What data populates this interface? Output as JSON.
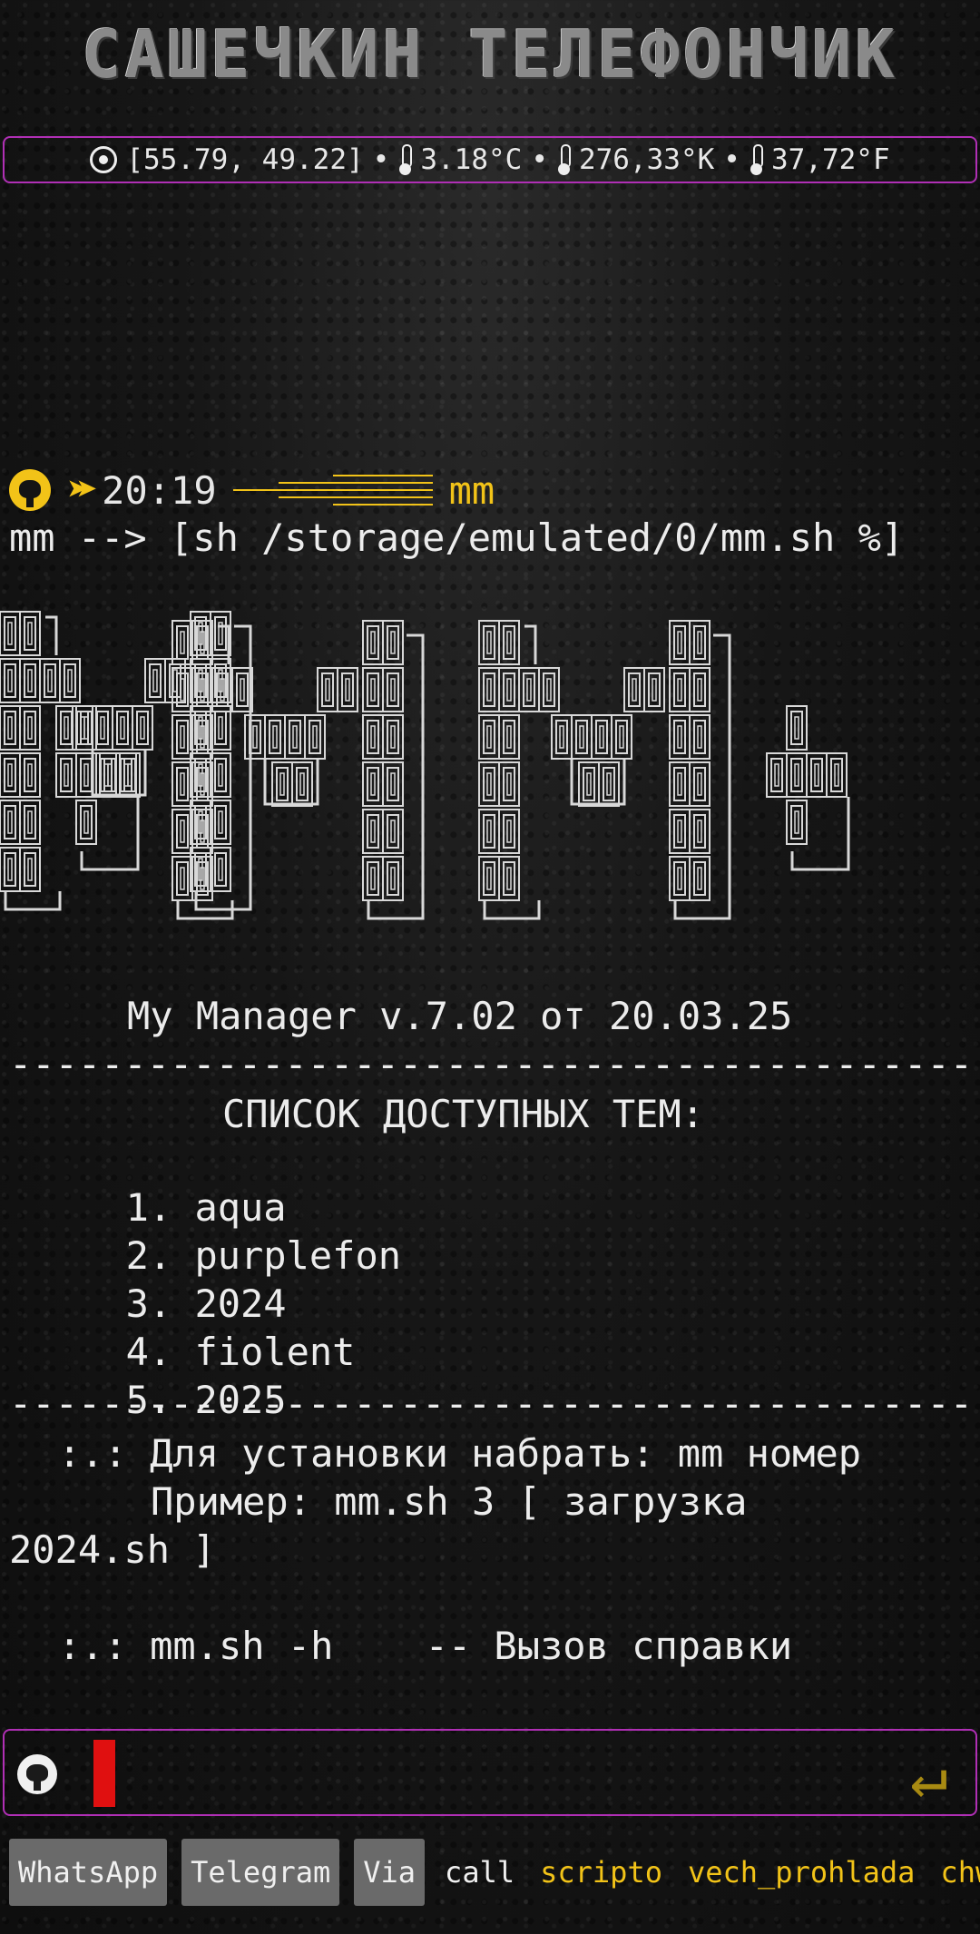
{
  "header": {
    "title": "САШЕЧКИН ТЕЛЕФОНЧИК"
  },
  "weather": {
    "coords": "[55.79, 49.22]",
    "temp_c": "3.18°C",
    "temp_k": "276,33°K",
    "temp_f": "37,72°F",
    "separator": "•"
  },
  "prompt": {
    "time": "20:19",
    "name": "mm",
    "arrows_icon": "double-arrow-icon"
  },
  "command_line": "mm --> [sh /storage/emulated/0/mm.sh %]",
  "logo": {
    "art_text": "MM"
  },
  "version_line": "My Manager v.7.02 от 20.03.25",
  "divider": "------------------------------------------",
  "themes": {
    "heading": "СПИСОК ДОСТУПНЫХ ТЕМ:",
    "items": [
      {
        "num": "1.",
        "name": "aqua"
      },
      {
        "num": "2.",
        "name": "purplefon"
      },
      {
        "num": "3.",
        "name": "2024"
      },
      {
        "num": "4.",
        "name": "fiolent"
      },
      {
        "num": "5.",
        "name": "2025"
      }
    ]
  },
  "help": {
    "install_line": ":.: Для установки набрать: mm номер",
    "example_line": "Пример: mm.sh 3 [ загрузка",
    "example_cont": "2024.sh ]",
    "help_line": ":.: mm.sh -h    -- Вызов справки"
  },
  "input": {
    "value": "",
    "enter_icon": "enter-icon"
  },
  "shortcuts": [
    {
      "label": "WhatsApp",
      "style": "chip"
    },
    {
      "label": "Telegram",
      "style": "chip"
    },
    {
      "label": "Via",
      "style": "chip"
    },
    {
      "label": "call",
      "style": "plain"
    },
    {
      "label": "scripto",
      "style": "yellow"
    },
    {
      "label": "vech_prohlada",
      "style": "yellow"
    },
    {
      "label": "chw",
      "style": "yellow"
    }
  ],
  "colors": {
    "accent_border": "#b02fb5",
    "highlight": "#f2c318",
    "cursor": "#e01010"
  }
}
